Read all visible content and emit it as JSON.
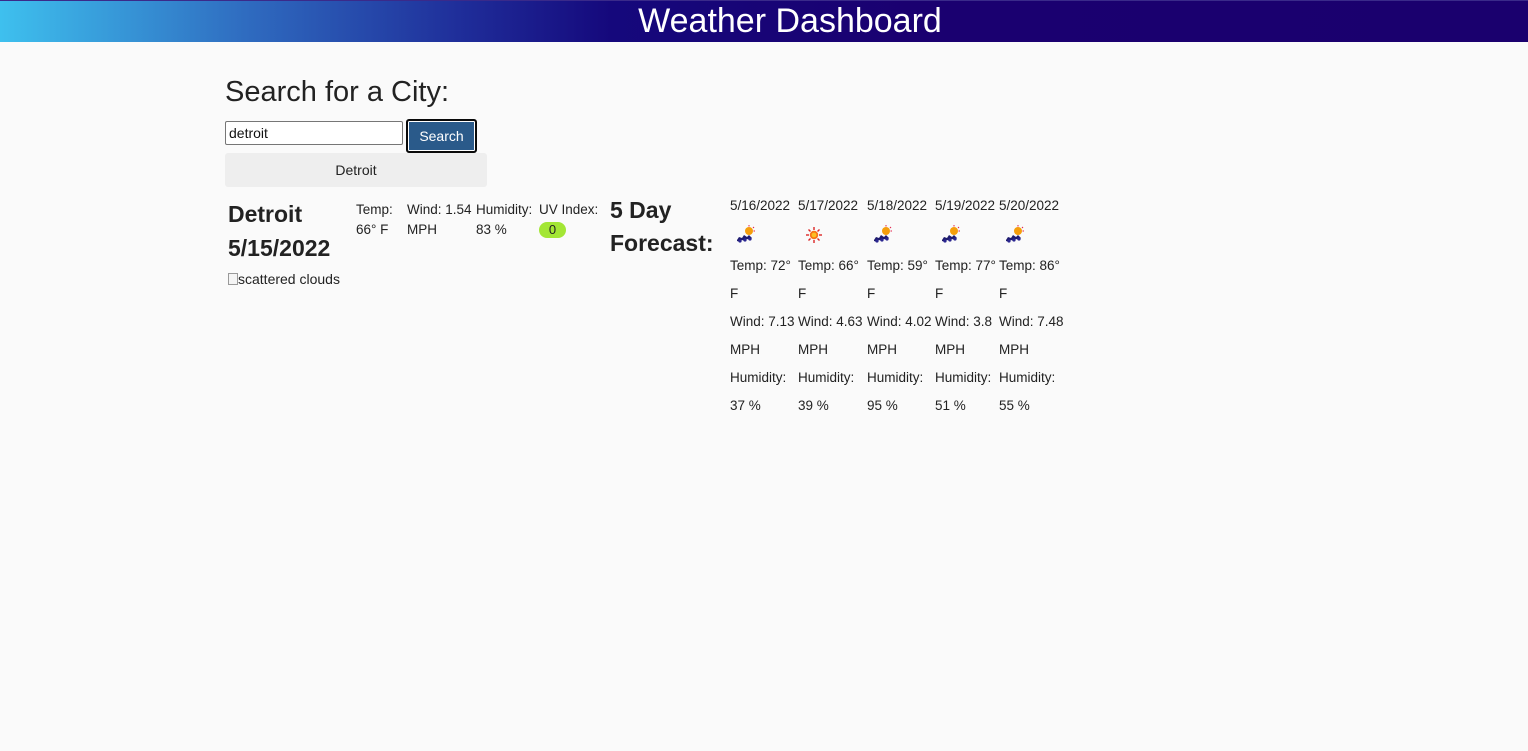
{
  "header": {
    "title": "Weather Dashboard"
  },
  "search": {
    "heading": "Search for a City:",
    "input_value": "detroit",
    "button_label": "Search",
    "history": [
      "Detroit"
    ]
  },
  "current": {
    "city": "Detroit",
    "date": "5/15/2022",
    "icon_alt": "scattered clouds",
    "temp_label": "Temp:",
    "temp_value": "66° F",
    "wind_label": "Wind: 1.54",
    "wind_unit": "MPH",
    "humidity_label": "Humidity:",
    "humidity_value": "83 %",
    "uv_label": "UV Index:",
    "uv_value": "0",
    "uv_color": "#a3e635"
  },
  "forecast": {
    "title_line1": "5 Day",
    "title_line2": "Forecast:",
    "days": [
      {
        "date": "5/16/2022",
        "icon": "scattered-clouds-icon",
        "temp": "Temp: 72°",
        "temp_unit": "F",
        "wind": "Wind: 7.13",
        "wind_unit": "MPH",
        "humidity_label": "Humidity:",
        "humidity": "37 %"
      },
      {
        "date": "5/17/2022",
        "icon": "sun-icon",
        "temp": "Temp: 66°",
        "temp_unit": "F",
        "wind": "Wind: 4.63",
        "wind_unit": "MPH",
        "humidity_label": "Humidity:",
        "humidity": "39 %"
      },
      {
        "date": "5/18/2022",
        "icon": "scattered-clouds-icon",
        "temp": "Temp: 59°",
        "temp_unit": "F",
        "wind": "Wind: 4.02",
        "wind_unit": "MPH",
        "humidity_label": "Humidity:",
        "humidity": "95 %"
      },
      {
        "date": "5/19/2022",
        "icon": "scattered-clouds-icon",
        "temp": "Temp: 77°",
        "temp_unit": "F",
        "wind": "Wind: 3.8",
        "wind_unit": "MPH",
        "humidity_label": "Humidity:",
        "humidity": "51 %"
      },
      {
        "date": "5/20/2022",
        "icon": "scattered-clouds-icon",
        "temp": "Temp: 86°",
        "temp_unit": "F",
        "wind": "Wind: 7.48",
        "wind_unit": "MPH",
        "humidity_label": "Humidity:",
        "humidity": "55 %"
      }
    ]
  }
}
